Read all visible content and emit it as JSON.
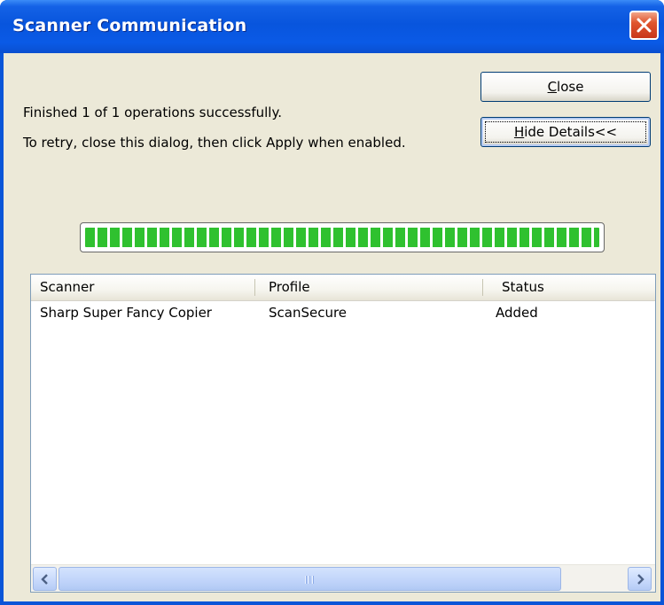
{
  "window": {
    "title": "Scanner Communication",
    "close_icon": "close-icon"
  },
  "messages": {
    "status": "Finished 1 of 1 operations successfully.",
    "retry": "To retry, close this dialog, then click Apply when enabled."
  },
  "buttons": {
    "close_mnemonic": "C",
    "close_rest": "lose",
    "details_mnemonic": "H",
    "details_rest": "ide Details<<"
  },
  "progress": {
    "fraction": 1.0
  },
  "list": {
    "columns": [
      "Scanner",
      "Profile",
      "Status"
    ],
    "rows": [
      [
        "Sharp Super Fancy Copier",
        "ScanSecure",
        "Added"
      ]
    ]
  },
  "scrollbar": {
    "left_icon": "chevron-left-icon",
    "right_icon": "chevron-right-icon"
  },
  "colors": {
    "titlebar": "#0855dd",
    "dialog_bg": "#ece9d8",
    "progress_fill": "#2fc12f",
    "close_button": "#d2461f"
  }
}
